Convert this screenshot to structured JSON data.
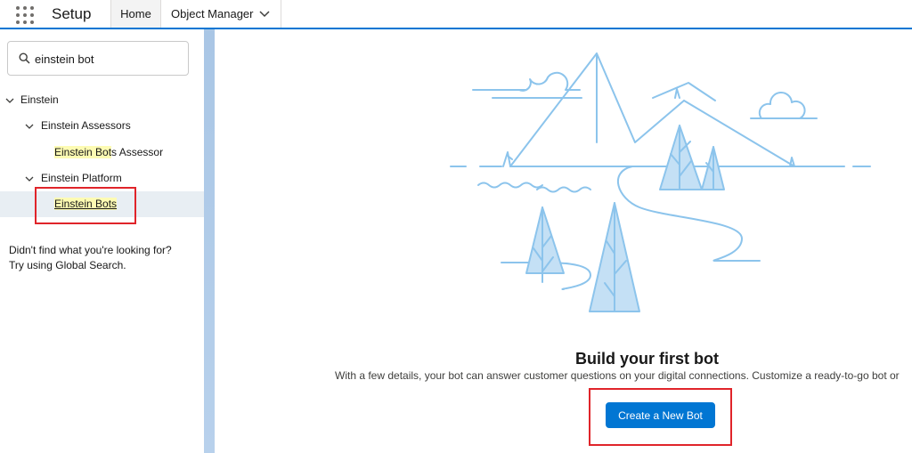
{
  "header": {
    "app_launcher_icon": "app-launcher-grid-icon",
    "app_title": "Setup",
    "tabs": [
      {
        "label": "Home",
        "active": true
      },
      {
        "label": "Object Manager",
        "active": false,
        "icon": "chevron-down-icon"
      }
    ],
    "accent_color": "#0176d3"
  },
  "sidebar": {
    "search": {
      "value": "einstein bot",
      "icon": "search-icon"
    },
    "tree": {
      "root": {
        "label": "Einstein",
        "expanded": true
      },
      "assessors": {
        "label": "Einstein Assessors",
        "expanded": true,
        "item": {
          "highlight": "Einstein Bot",
          "rest": "s Assessor"
        }
      },
      "platform": {
        "label": "Einstein Platform",
        "expanded": true,
        "item": {
          "highlight": "Einstein Bots",
          "rest": "",
          "selected": true
        }
      }
    },
    "help_line1": "Didn't find what you're looking for?",
    "help_line2": "Try using Global Search.",
    "highlight_color": "#fdfbb3",
    "selected_color": "#e8eef3"
  },
  "main": {
    "illustration": "mountains-trees-river-illustration",
    "empty_state": {
      "title": "Build your first bot",
      "description": "With a few details, your bot can answer customer questions on your digital connections. Customize a ready-to-go bot or",
      "button_label": "Create a New Bot"
    },
    "annotation_color": "#e0242a"
  }
}
